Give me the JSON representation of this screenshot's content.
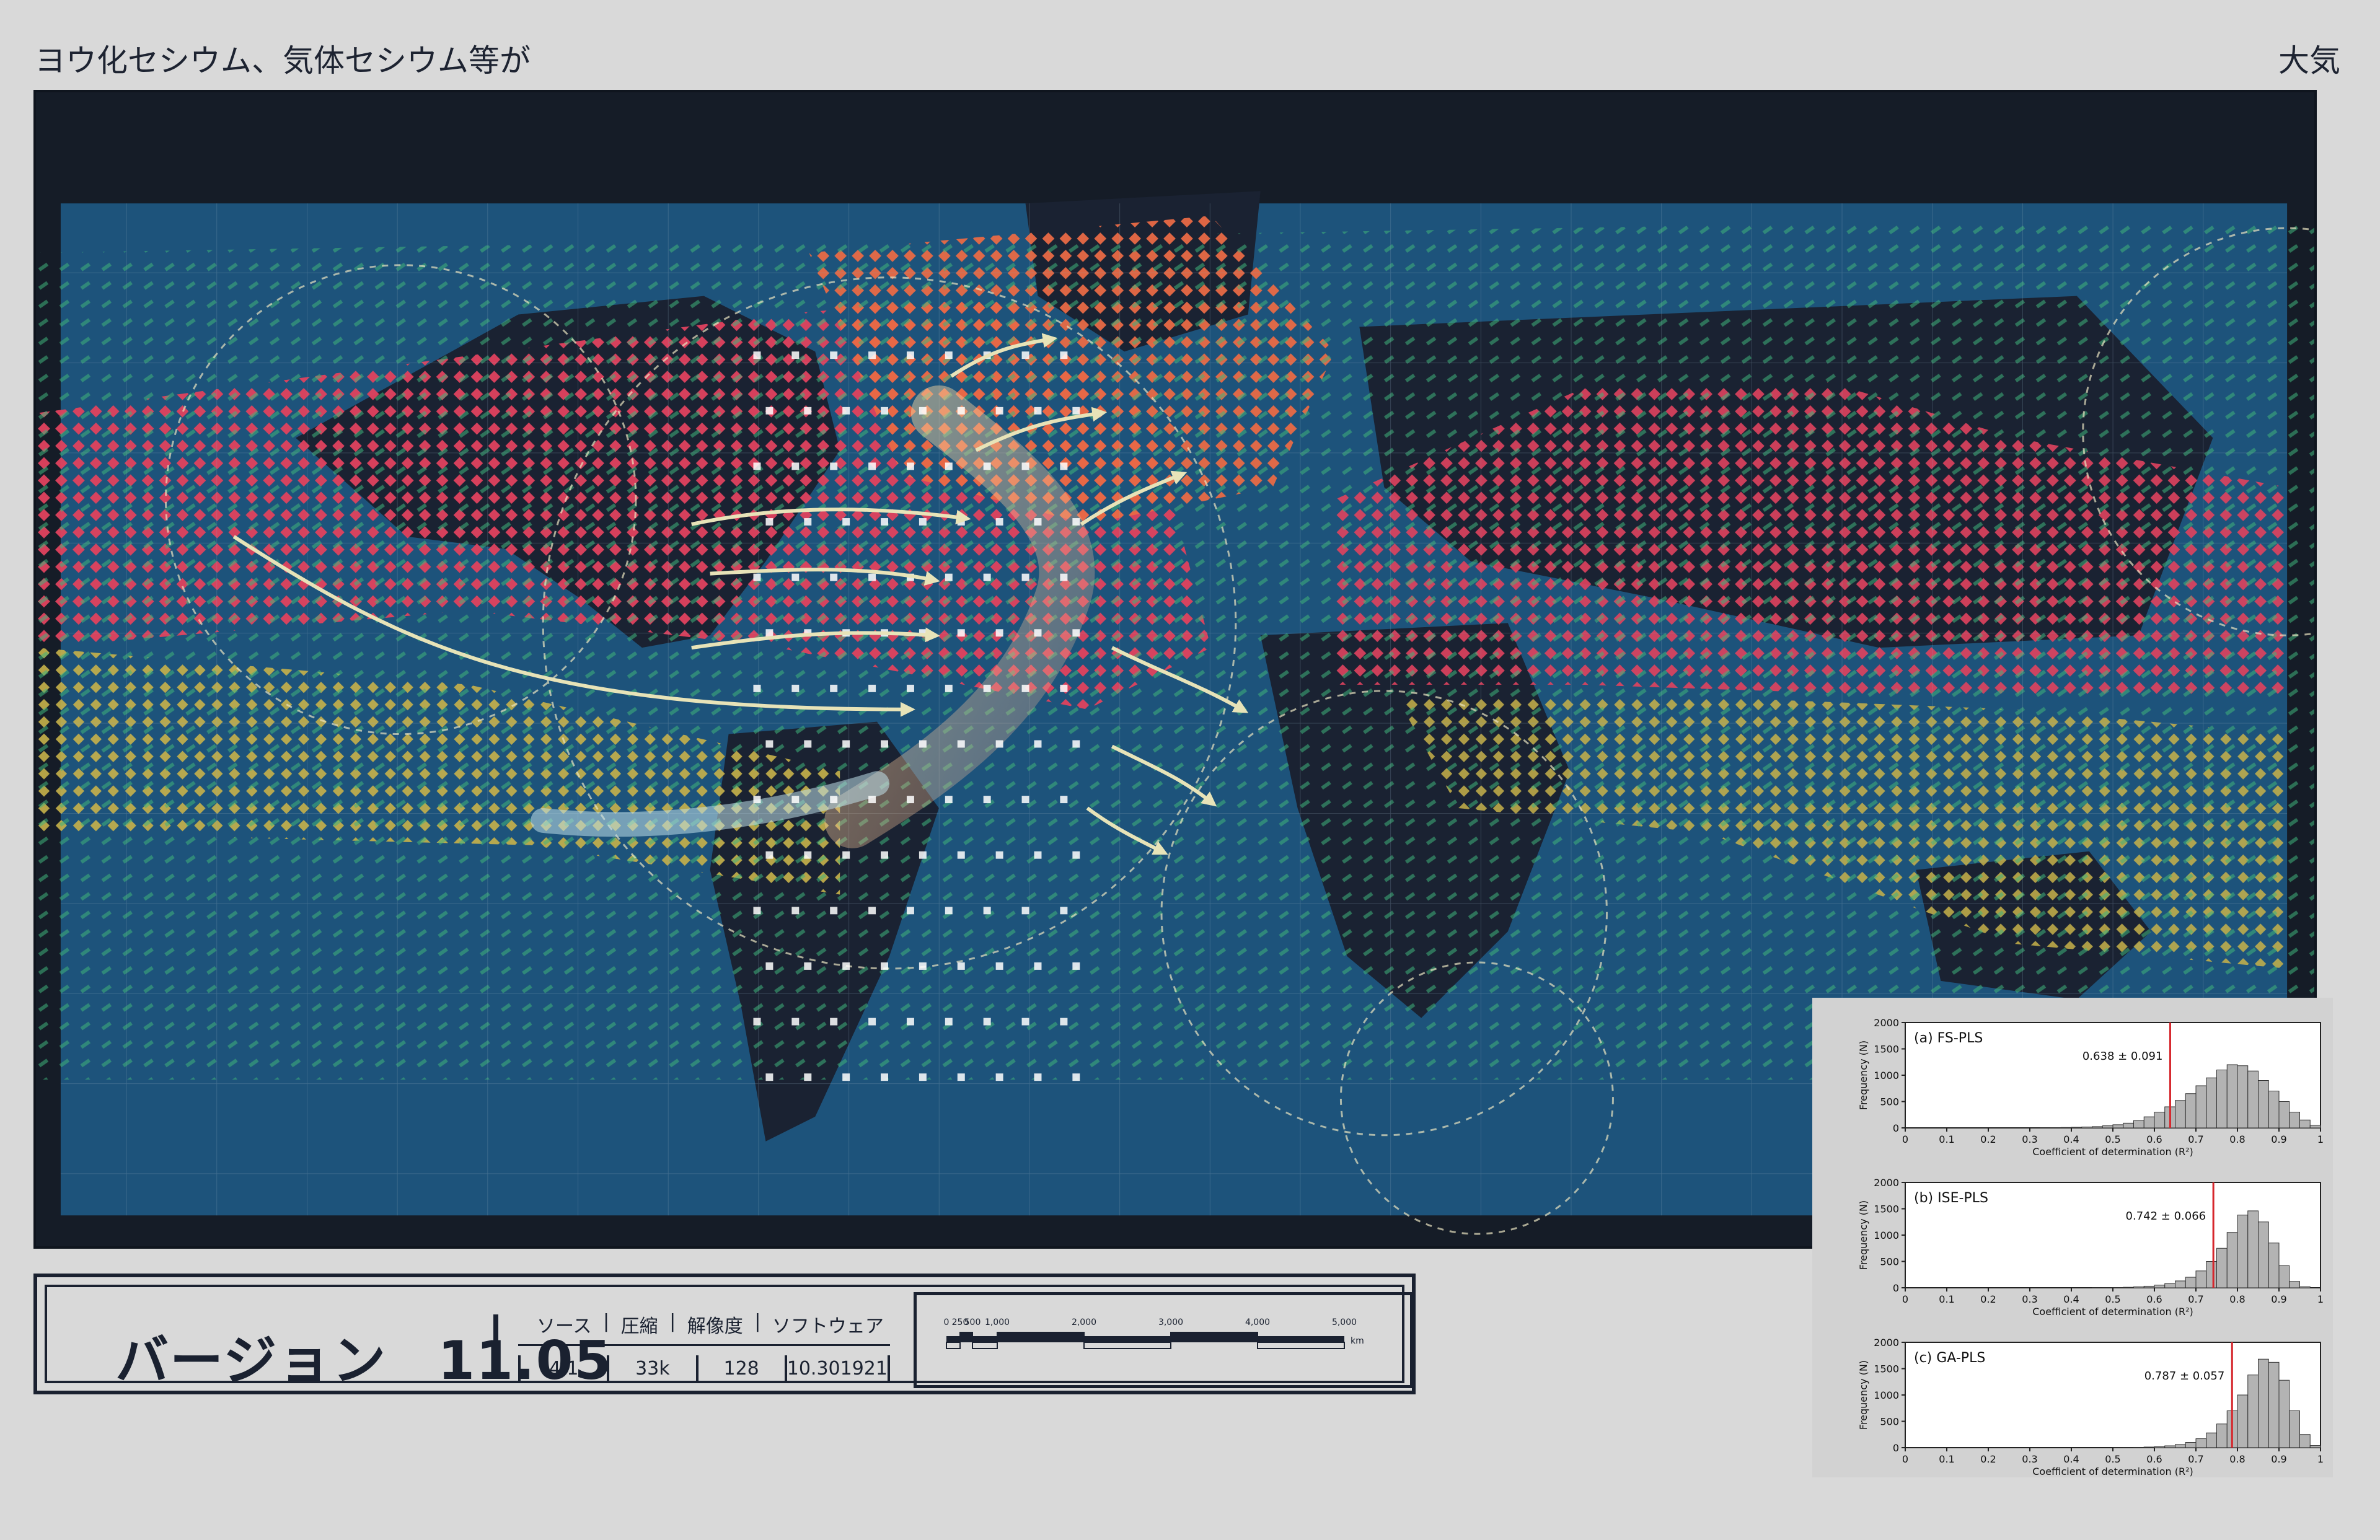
{
  "header": {
    "left_title": "ヨウ化セシウム、気体セシウム等が",
    "right_title": "大気"
  },
  "info": {
    "version_label": "バージョン",
    "version_number": "11.05",
    "meta_headers": [
      "ソース",
      "圧縮",
      "解像度",
      "ソフトウェア"
    ],
    "meta_values": [
      "4.1",
      "33k",
      "128",
      "10.301921"
    ]
  },
  "scale": {
    "ticks": [
      "0",
      "250",
      "500",
      "1,000",
      "2,000",
      "3,000",
      "4,000",
      "5,000"
    ],
    "unit": "km"
  },
  "colors": {
    "ocean": "#1e5a85",
    "land": "#1a2232",
    "red_band": "#e0425e",
    "orange_band": "#e86a45",
    "yellow_band": "#c7b24a",
    "green_dots": "#3fb37a",
    "arrow": "#e7e3b8"
  },
  "histograms": [
    {
      "panel_label": "(a) FS-PLS",
      "stat_label": "0.638 ± 0.091",
      "mean": 0.638,
      "ylabel": "Frequency (N)",
      "xlabel": "Coefficient of determination (R²)",
      "yticks": [
        "2000",
        "1500",
        "1000",
        "500",
        "0"
      ],
      "xticks": [
        "0",
        "0.1",
        "0.2",
        "0.3",
        "0.4",
        "0.5",
        "0.6",
        "0.7",
        "0.8",
        "0.9",
        "1"
      ],
      "ymax": 2000,
      "bin_width": 0.025,
      "counts": [
        0,
        0,
        0,
        0,
        0,
        0,
        0,
        0,
        0,
        0,
        0,
        0,
        0,
        2,
        5,
        8,
        12,
        18,
        25,
        40,
        60,
        90,
        140,
        210,
        300,
        400,
        520,
        650,
        800,
        950,
        1100,
        1200,
        1180,
        1080,
        900,
        700,
        500,
        300,
        150,
        50
      ]
    },
    {
      "panel_label": "(b) ISE-PLS",
      "stat_label": "0.742 ± 0.066",
      "mean": 0.742,
      "ylabel": "Frequency (N)",
      "xlabel": "Coefficient of determination (R²)",
      "yticks": [
        "2000",
        "1500",
        "1000",
        "500",
        "0"
      ],
      "xticks": [
        "0",
        "0.1",
        "0.2",
        "0.3",
        "0.4",
        "0.5",
        "0.6",
        "0.7",
        "0.8",
        "0.9",
        "1"
      ],
      "ymax": 2000,
      "bin_width": 0.025,
      "counts": [
        0,
        0,
        0,
        0,
        0,
        0,
        0,
        0,
        0,
        0,
        0,
        0,
        0,
        0,
        0,
        0,
        0,
        0,
        1,
        3,
        6,
        10,
        18,
        30,
        50,
        80,
        130,
        200,
        320,
        500,
        750,
        1050,
        1380,
        1460,
        1250,
        850,
        420,
        120,
        20,
        0
      ]
    },
    {
      "panel_label": "(c) GA-PLS",
      "stat_label": "0.787 ± 0.057",
      "mean": 0.787,
      "ylabel": "Frequency (N)",
      "xlabel": "Coefficient of determination (R²)",
      "yticks": [
        "2000",
        "1500",
        "1000",
        "500",
        "0"
      ],
      "xticks": [
        "0",
        "0.1",
        "0.2",
        "0.3",
        "0.4",
        "0.5",
        "0.6",
        "0.7",
        "0.8",
        "0.9",
        "1"
      ],
      "ymax": 2000,
      "bin_width": 0.025,
      "counts": [
        0,
        0,
        0,
        0,
        0,
        0,
        0,
        0,
        0,
        0,
        0,
        0,
        0,
        0,
        0,
        0,
        0,
        0,
        0,
        0,
        1,
        3,
        6,
        12,
        20,
        35,
        60,
        100,
        170,
        280,
        450,
        700,
        1000,
        1380,
        1680,
        1620,
        1280,
        700,
        250,
        40
      ]
    }
  ]
}
